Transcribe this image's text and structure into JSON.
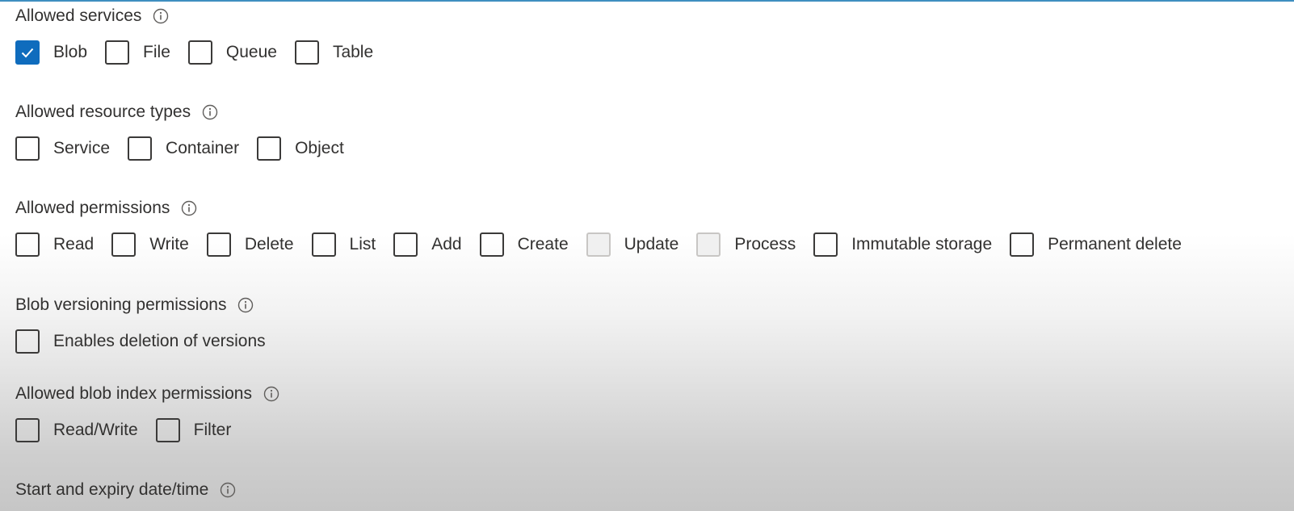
{
  "sections": [
    {
      "heading": "Allowed services",
      "options": [
        {
          "label": "Blob",
          "checked": true,
          "disabled": false
        },
        {
          "label": "File",
          "checked": false,
          "disabled": false
        },
        {
          "label": "Queue",
          "checked": false,
          "disabled": false
        },
        {
          "label": "Table",
          "checked": false,
          "disabled": false
        }
      ]
    },
    {
      "heading": "Allowed resource types",
      "options": [
        {
          "label": "Service",
          "checked": false,
          "disabled": false
        },
        {
          "label": "Container",
          "checked": false,
          "disabled": false
        },
        {
          "label": "Object",
          "checked": false,
          "disabled": false
        }
      ]
    },
    {
      "heading": "Allowed permissions",
      "options": [
        {
          "label": "Read",
          "checked": false,
          "disabled": false
        },
        {
          "label": "Write",
          "checked": false,
          "disabled": false
        },
        {
          "label": "Delete",
          "checked": false,
          "disabled": false
        },
        {
          "label": "List",
          "checked": false,
          "disabled": false
        },
        {
          "label": "Add",
          "checked": false,
          "disabled": false
        },
        {
          "label": "Create",
          "checked": false,
          "disabled": false
        },
        {
          "label": "Update",
          "checked": false,
          "disabled": true
        },
        {
          "label": "Process",
          "checked": false,
          "disabled": true
        },
        {
          "label": "Immutable storage",
          "checked": false,
          "disabled": false
        },
        {
          "label": "Permanent delete",
          "checked": false,
          "disabled": false
        }
      ]
    },
    {
      "heading": "Blob versioning permissions",
      "options": [
        {
          "label": "Enables deletion of versions",
          "checked": false,
          "disabled": false
        }
      ]
    },
    {
      "heading": "Allowed blob index permissions",
      "options": [
        {
          "label": "Read/Write",
          "checked": false,
          "disabled": false
        },
        {
          "label": "Filter",
          "checked": false,
          "disabled": false
        }
      ]
    },
    {
      "heading": "Start and expiry date/time",
      "options": []
    }
  ],
  "icons": {
    "info": "info-icon",
    "check": "checkmark-icon"
  },
  "colors": {
    "checked_fill": "#0f6cbd",
    "checkbox_border": "#3b3a39",
    "disabled_border": "#c8c6c4",
    "text": "#323130",
    "top_line": "#3f8fc0"
  }
}
